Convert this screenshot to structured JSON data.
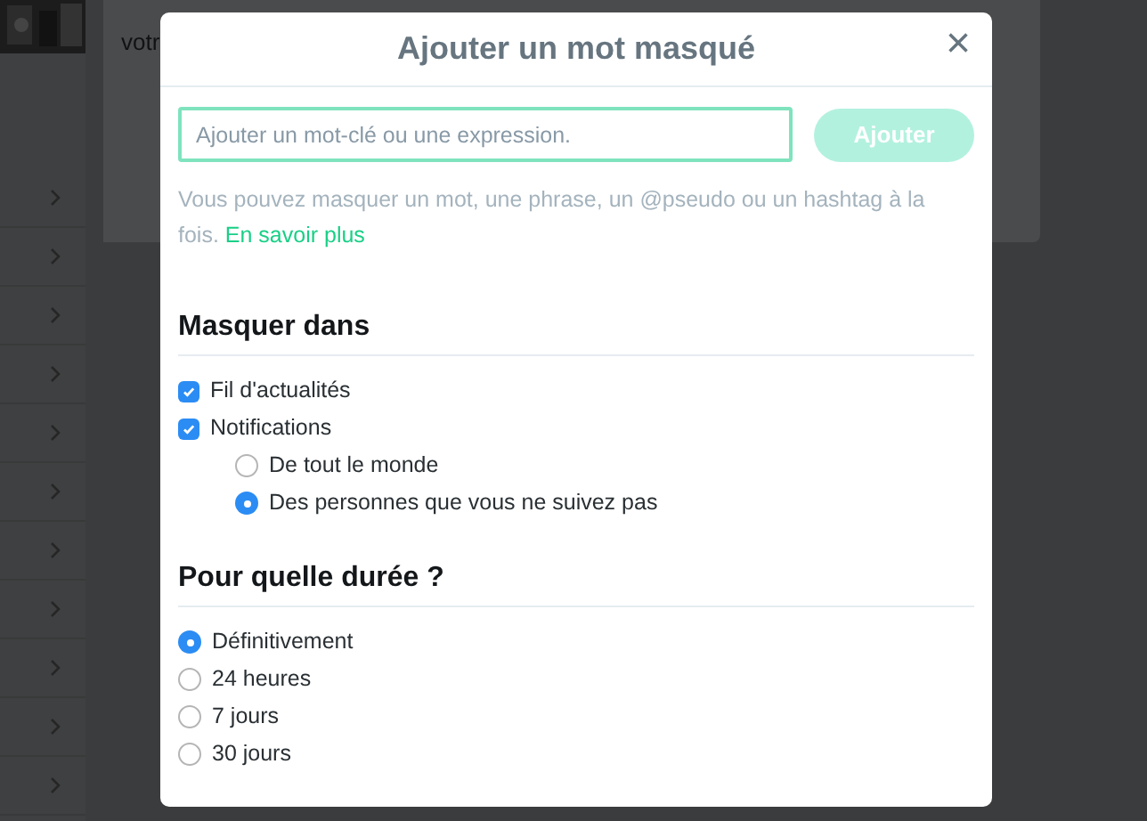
{
  "background": {
    "text_lines": [
      "votr"
    ]
  },
  "dialog": {
    "title": "Ajouter un mot masqué",
    "close": "×",
    "input": {
      "placeholder": "Ajouter un mot-clé ou une expression."
    },
    "add_button": {
      "label": "Ajouter",
      "disabled": true
    },
    "hint": "Vous pouvez masquer un mot, une phrase, un @pseudo ou un hashtag à la fois.",
    "hint_link": "En savoir plus",
    "sections": [
      {
        "heading": "Masquer dans",
        "options": [
          {
            "kind": "checkbox",
            "label": "Fil d'actualités",
            "checked": true
          },
          {
            "kind": "checkbox",
            "label": "Notifications",
            "checked": true,
            "children": [
              {
                "kind": "radio",
                "label": "De tout le monde",
                "selected": false
              },
              {
                "kind": "radio",
                "label": "Des personnes que vous ne suivez pas",
                "selected": true
              }
            ]
          }
        ]
      },
      {
        "heading": "Pour quelle durée ?",
        "options": [
          {
            "kind": "radio",
            "label": "Définitivement",
            "selected": true
          },
          {
            "kind": "radio",
            "label": "24 heures",
            "selected": false
          },
          {
            "kind": "radio",
            "label": "7 jours",
            "selected": false
          },
          {
            "kind": "radio",
            "label": "30 jours",
            "selected": false
          }
        ]
      }
    ]
  }
}
